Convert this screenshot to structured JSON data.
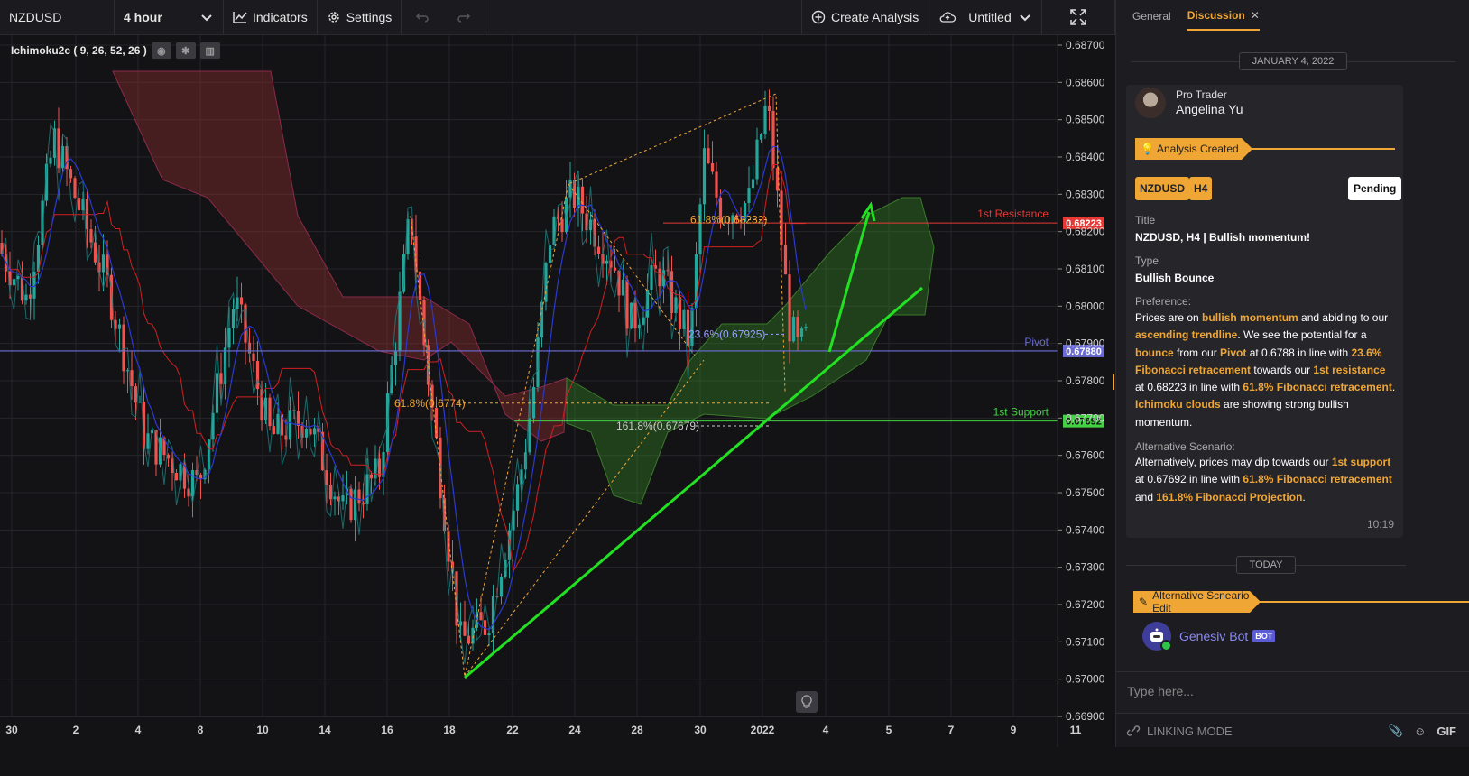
{
  "toolbar": {
    "symbol": "NZDUSD",
    "timeframe": "4 hour",
    "indicators_label": "Indicators",
    "settings_label": "Settings",
    "create_label": "Create Analysis",
    "project_label": "Untitled"
  },
  "chart": {
    "indicator_label": "Ichimoku2c ( 9, 26, 52, 26 )",
    "price_labels": [
      "0.68700",
      "0.68600",
      "0.68500",
      "0.68400",
      "0.68300",
      "0.68200",
      "0.68100",
      "0.68000",
      "0.67900",
      "0.67800",
      "0.67700",
      "0.67600",
      "0.67500",
      "0.67400",
      "0.67300",
      "0.67200",
      "0.67100",
      "0.67000",
      "0.66900"
    ],
    "date_labels": [
      "30",
      "2",
      "4",
      "8",
      "10",
      "14",
      "16",
      "18",
      "22",
      "24",
      "28",
      "30",
      "2022",
      "4",
      "5",
      "7",
      "9",
      "11"
    ],
    "levels": {
      "resistance": {
        "name": "1st Resistance",
        "value": "0.68223",
        "color": "#e53935"
      },
      "pivot": {
        "name": "Pivot",
        "value": "0.67880",
        "color": "#6b6bd6"
      },
      "support": {
        "name": "1st Support",
        "value": "0.67692",
        "color": "#43d243"
      }
    },
    "fib_labels": {
      "fib_618_top": "61.8%(0.68232)",
      "fib_236": "23.6%(0.67925)",
      "fib_618_mid": "61.8%(0.6774)",
      "fib_1618": "161.8%(0.67679)"
    },
    "colors": {
      "bull": "#26a69a",
      "bear": "#ef5350",
      "trend": "#22e022",
      "fib": "#f0a634"
    }
  },
  "panel": {
    "tabs": {
      "general": "General",
      "discussion": "Discussion"
    },
    "date1": "JANUARY 4, 2022",
    "author_role": "Pro Trader",
    "author_name": "Angelina Yu",
    "banner1": "Analysis Created",
    "badge_symbol": "NZDUSD",
    "badge_tf": "H4",
    "status": "Pending",
    "title_label": "Title",
    "title_value": "NZDUSD, H4 | Bullish momentum!",
    "type_label": "Type",
    "type_value": "Bullish Bounce",
    "preference_label": "Preference:",
    "pref": {
      "t1": "Prices are on ",
      "h1": "bullish momentum",
      "t2": " and abiding to our ",
      "h2": "ascending trendline",
      "t3": ". We see the potential for a ",
      "h3": "bounce",
      "t4": " from our ",
      "h4": "Pivot",
      "t5": " at 0.6788 in line with ",
      "h5": "23.6% Fibonacci retracement",
      "t6": " towards our ",
      "h6": "1st resistance",
      "t7": " at 0.68223 in line with ",
      "h7": "61.8% Fibonacci retracement",
      "t8": ". ",
      "h8": "Ichimoku clouds",
      "t9": " are showing strong bullish momentum."
    },
    "alt_label": "Alternative Scenario:",
    "alt": {
      "t1": "Alternatively, prices may dip towards our ",
      "h1": "1st support",
      "t2": " at 0.67692 in line with ",
      "h2": "61.8% Fibonacci retracement",
      "t3": " and ",
      "h3": "161.8% Fibonacci Projection",
      "t4": "."
    },
    "time": "10:19",
    "date2": "TODAY",
    "banner2": "Alternative Scneario Edit",
    "bot_name": "Genesiv Bot",
    "bot_badge": "BOT",
    "composer_placeholder": "Type here...",
    "linking_label": "LINKING MODE",
    "gif_label": "GIF"
  }
}
